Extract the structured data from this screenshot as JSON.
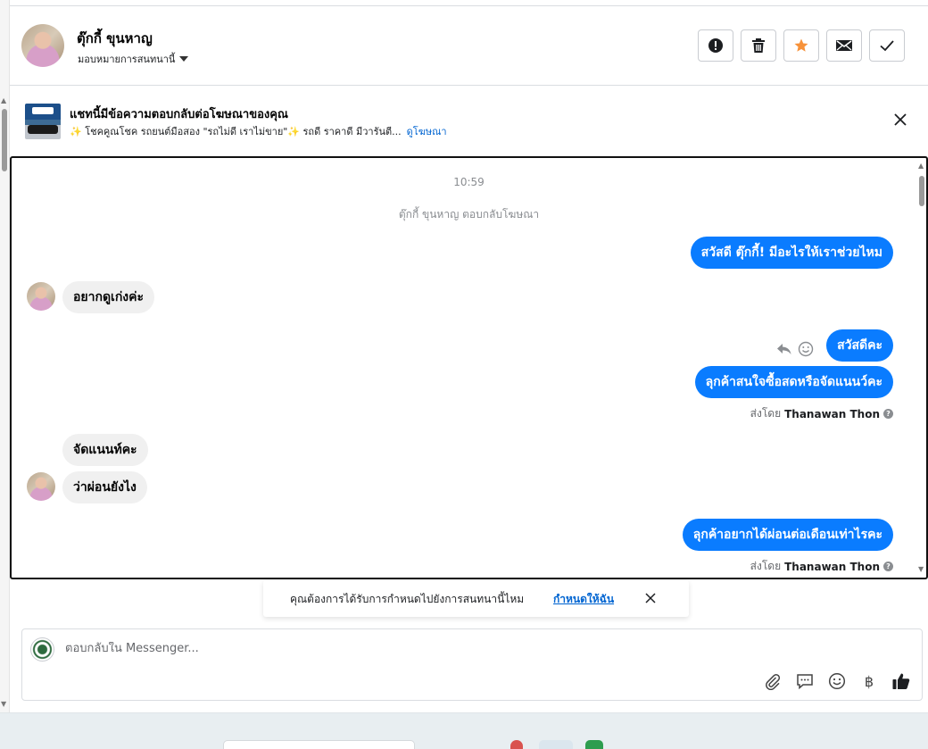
{
  "header": {
    "contact_name": "ตุ๊กกี้ ขุนหาญ",
    "assign_label": "มอบหมายการสนทนานี้",
    "buttons": [
      {
        "name": "report-button",
        "icon": "alert-icon"
      },
      {
        "name": "delete-button",
        "icon": "trash-icon"
      },
      {
        "name": "star-button",
        "icon": "star-icon"
      },
      {
        "name": "mark-unread-button",
        "icon": "envelope-icon"
      },
      {
        "name": "mark-done-button",
        "icon": "check-icon"
      }
    ]
  },
  "ad": {
    "title": "แชทนี้มีข้อความตอบกลับต่อโฆษณาของคุณ",
    "text": "✨ โชคคูณโชค รถยนต์มือสอง \"รถไม่ดี เราไม่ขาย\"✨ รถดี ราคาดี มีวารันตี...",
    "link": "ดูโฆษณา"
  },
  "conversation": {
    "time": "10:59",
    "system_message": "ตุ๊กกี้ ขุนหาญ ตอบกลับโฆษณา",
    "messages": [
      {
        "dir": "out",
        "text": "สวัสดี ตุ๊กกี้! มีอะไรให้เราช่วยไหม"
      },
      {
        "dir": "in",
        "text": "อยากดูเก่งค่ะ"
      },
      {
        "dir": "out",
        "text": "สวัสดีคะ"
      },
      {
        "dir": "out",
        "text": "ลุกค้าสนใจซื้อสดหรือจัดแนนว์คะ"
      },
      {
        "dir": "in",
        "text": "จัดแนนท์คะ"
      },
      {
        "dir": "in",
        "text": "ว่าผ่อนยังไง"
      },
      {
        "dir": "out",
        "text": "ลุกค้าอยากได้ผ่อนต่อเดือนเท่าไรคะ"
      }
    ],
    "sent_by_label": "ส่งโดย",
    "sent_by_name": "Thanawan Thon",
    "help_mark": "?"
  },
  "toast": {
    "text": "คุณต้องการได้รับการกำหนดไปยังการสนทนานี้ไหม",
    "link": "กำหนดให้ฉัน"
  },
  "composer": {
    "placeholder": "ตอบกลับใน Messenger...",
    "currency_symbol": "฿"
  },
  "colors": {
    "accent": "#0a7cff",
    "star": "#f7923a",
    "link": "#0064d1"
  }
}
